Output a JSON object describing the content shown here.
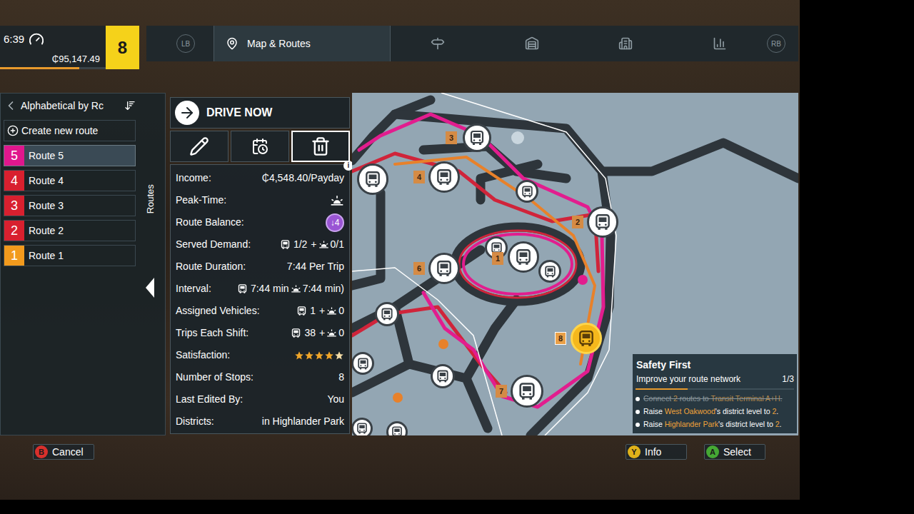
{
  "hud": {
    "time": "6:39",
    "money": "₵95,147.49",
    "level": "8",
    "xp_level": 0.75
  },
  "tab_bar": {
    "prev_key": "LB",
    "next_key": "RB",
    "tabs": [
      {
        "label": "Map & Routes",
        "kind": "map",
        "selected": true
      },
      {
        "label": "",
        "kind": "stops",
        "selected": false
      },
      {
        "label": "",
        "kind": "depot",
        "selected": false
      },
      {
        "label": "",
        "kind": "districts",
        "selected": false
      },
      {
        "label": "",
        "kind": "stats",
        "selected": false
      }
    ]
  },
  "sort_label": "Alphabetical by Rc",
  "create_route": "Create new route",
  "side_label": "Routes",
  "routes": [
    {
      "number": "5",
      "name": "Route 5",
      "color": "#e0178d",
      "selected": true
    },
    {
      "number": "4",
      "name": "Route 4",
      "color": "#d8202f",
      "selected": false
    },
    {
      "number": "3",
      "name": "Route 3",
      "color": "#d8202f",
      "selected": false
    },
    {
      "number": "2",
      "name": "Route 2",
      "color": "#d8202f",
      "selected": false
    },
    {
      "number": "1",
      "name": "Route 1",
      "color": "#f29a1d",
      "selected": false
    }
  ],
  "details": {
    "drive_now": "DRIVE NOW",
    "actions": [
      {
        "kind": "edit",
        "selected": false
      },
      {
        "kind": "schedule",
        "selected": false
      },
      {
        "kind": "delete",
        "selected": true
      }
    ],
    "info_badge": "i",
    "stats": [
      {
        "label": "Income:",
        "kind": "text",
        "value": "₵4,548.40/Payday"
      },
      {
        "label": "Peak-Time:",
        "kind": "peak_icon"
      },
      {
        "label": "Route Balance:",
        "kind": "badge",
        "value": "↓4"
      },
      {
        "label": "Served Demand:",
        "kind": "split",
        "bus": "1/2",
        "sep": "+",
        "peak": "0/1"
      },
      {
        "label": "Route Duration:",
        "kind": "text",
        "value": "7:44 Per Trip"
      },
      {
        "label": "Interval:",
        "kind": "split",
        "bus": "7:44 min",
        "sep": "",
        "peak": "7:44 min)"
      },
      {
        "label": "Assigned Vehicles:",
        "kind": "split",
        "bus": "1",
        "sep": "+",
        "peak": "0"
      },
      {
        "label": "Trips Each Shift:",
        "kind": "split",
        "bus": "38",
        "sep": "+",
        "peak": "0"
      },
      {
        "label": "Satisfaction:",
        "kind": "stars",
        "stars": 4,
        "max": 5
      },
      {
        "label": "Number of Stops:",
        "kind": "text",
        "value": "8"
      },
      {
        "label": "Last Edited By:",
        "kind": "text",
        "value": "You"
      },
      {
        "label": "Districts:",
        "kind": "text",
        "value": "in Highlander Park"
      }
    ]
  },
  "map": {
    "stops": [
      {
        "number": "3",
        "selected": false
      },
      {
        "number": "4",
        "selected": false
      },
      {
        "number": "2",
        "selected": false
      },
      {
        "number": "1",
        "selected": false
      },
      {
        "number": "6",
        "selected": false
      },
      {
        "number": "8",
        "selected": true
      },
      {
        "number": "7",
        "selected": false
      }
    ]
  },
  "quest": {
    "title": "Safety First",
    "subtitle": "Improve your route network",
    "count": "1/3",
    "level": 0.33,
    "tasks": [
      {
        "done": true,
        "segments": [
          {
            "text": "Connect ",
            "highlight": false
          },
          {
            "text": "2",
            "highlight": true
          },
          {
            "text": " routes to ",
            "highlight": false
          },
          {
            "text": "Transit Terminal A+H",
            "highlight": true
          },
          {
            "text": ".",
            "highlight": false
          }
        ]
      },
      {
        "done": false,
        "segments": [
          {
            "text": "Raise ",
            "highlight": false
          },
          {
            "text": "West Oakwood",
            "highlight": true
          },
          {
            "text": "'s district level to ",
            "highlight": false
          },
          {
            "text": "2",
            "highlight": true
          },
          {
            "text": ".",
            "highlight": false
          }
        ]
      },
      {
        "done": false,
        "segments": [
          {
            "text": "Raise ",
            "highlight": false
          },
          {
            "text": "Highlander Park",
            "highlight": true
          },
          {
            "text": "'s district level to ",
            "highlight": false
          },
          {
            "text": "2",
            "highlight": true
          },
          {
            "text": ".",
            "highlight": false
          }
        ]
      }
    ]
  },
  "footer": [
    {
      "key": "B",
      "label": "Cancel",
      "color": "#d8302c"
    },
    {
      "key": "Y",
      "label": "Info",
      "color": "#e0b21a"
    },
    {
      "key": "A",
      "label": "Select",
      "color": "#45a834"
    }
  ]
}
